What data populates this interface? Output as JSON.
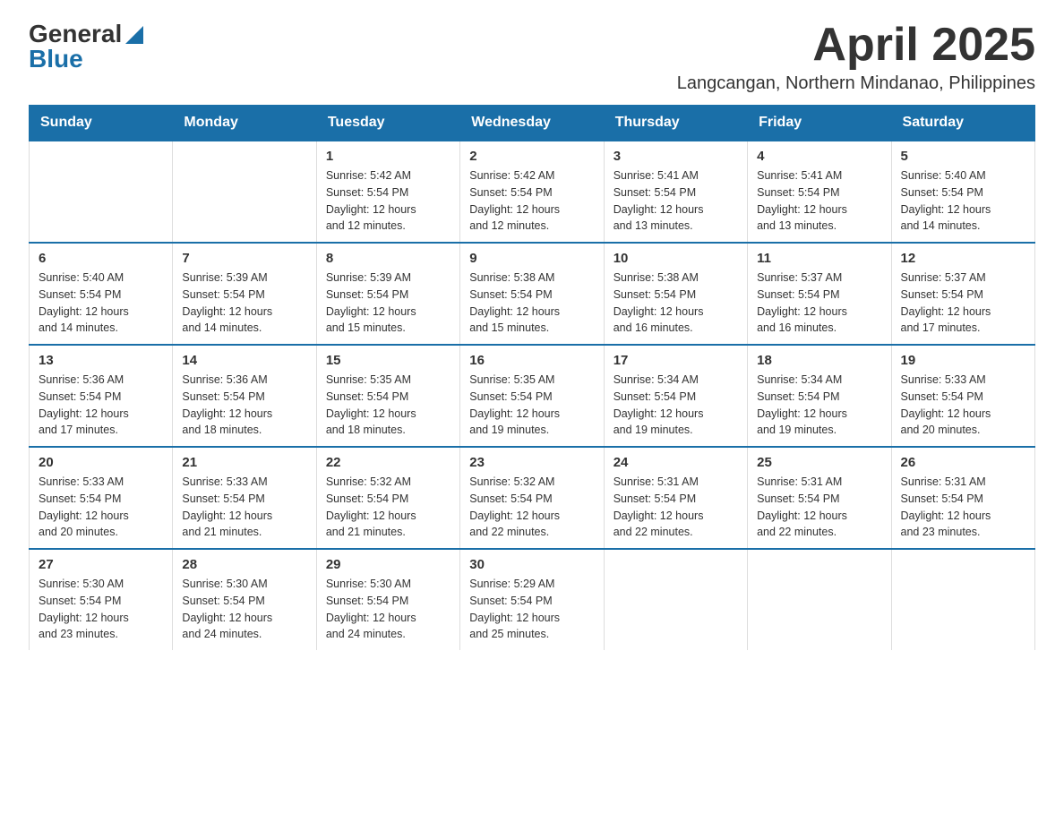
{
  "logo": {
    "general": "General",
    "blue": "Blue"
  },
  "title": "April 2025",
  "location": "Langcangan, Northern Mindanao, Philippines",
  "header": {
    "days": [
      "Sunday",
      "Monday",
      "Tuesday",
      "Wednesday",
      "Thursday",
      "Friday",
      "Saturday"
    ]
  },
  "weeks": [
    [
      {
        "day": "",
        "info": ""
      },
      {
        "day": "",
        "info": ""
      },
      {
        "day": "1",
        "info": "Sunrise: 5:42 AM\nSunset: 5:54 PM\nDaylight: 12 hours\nand 12 minutes."
      },
      {
        "day": "2",
        "info": "Sunrise: 5:42 AM\nSunset: 5:54 PM\nDaylight: 12 hours\nand 12 minutes."
      },
      {
        "day": "3",
        "info": "Sunrise: 5:41 AM\nSunset: 5:54 PM\nDaylight: 12 hours\nand 13 minutes."
      },
      {
        "day": "4",
        "info": "Sunrise: 5:41 AM\nSunset: 5:54 PM\nDaylight: 12 hours\nand 13 minutes."
      },
      {
        "day": "5",
        "info": "Sunrise: 5:40 AM\nSunset: 5:54 PM\nDaylight: 12 hours\nand 14 minutes."
      }
    ],
    [
      {
        "day": "6",
        "info": "Sunrise: 5:40 AM\nSunset: 5:54 PM\nDaylight: 12 hours\nand 14 minutes."
      },
      {
        "day": "7",
        "info": "Sunrise: 5:39 AM\nSunset: 5:54 PM\nDaylight: 12 hours\nand 14 minutes."
      },
      {
        "day": "8",
        "info": "Sunrise: 5:39 AM\nSunset: 5:54 PM\nDaylight: 12 hours\nand 15 minutes."
      },
      {
        "day": "9",
        "info": "Sunrise: 5:38 AM\nSunset: 5:54 PM\nDaylight: 12 hours\nand 15 minutes."
      },
      {
        "day": "10",
        "info": "Sunrise: 5:38 AM\nSunset: 5:54 PM\nDaylight: 12 hours\nand 16 minutes."
      },
      {
        "day": "11",
        "info": "Sunrise: 5:37 AM\nSunset: 5:54 PM\nDaylight: 12 hours\nand 16 minutes."
      },
      {
        "day": "12",
        "info": "Sunrise: 5:37 AM\nSunset: 5:54 PM\nDaylight: 12 hours\nand 17 minutes."
      }
    ],
    [
      {
        "day": "13",
        "info": "Sunrise: 5:36 AM\nSunset: 5:54 PM\nDaylight: 12 hours\nand 17 minutes."
      },
      {
        "day": "14",
        "info": "Sunrise: 5:36 AM\nSunset: 5:54 PM\nDaylight: 12 hours\nand 18 minutes."
      },
      {
        "day": "15",
        "info": "Sunrise: 5:35 AM\nSunset: 5:54 PM\nDaylight: 12 hours\nand 18 minutes."
      },
      {
        "day": "16",
        "info": "Sunrise: 5:35 AM\nSunset: 5:54 PM\nDaylight: 12 hours\nand 19 minutes."
      },
      {
        "day": "17",
        "info": "Sunrise: 5:34 AM\nSunset: 5:54 PM\nDaylight: 12 hours\nand 19 minutes."
      },
      {
        "day": "18",
        "info": "Sunrise: 5:34 AM\nSunset: 5:54 PM\nDaylight: 12 hours\nand 19 minutes."
      },
      {
        "day": "19",
        "info": "Sunrise: 5:33 AM\nSunset: 5:54 PM\nDaylight: 12 hours\nand 20 minutes."
      }
    ],
    [
      {
        "day": "20",
        "info": "Sunrise: 5:33 AM\nSunset: 5:54 PM\nDaylight: 12 hours\nand 20 minutes."
      },
      {
        "day": "21",
        "info": "Sunrise: 5:33 AM\nSunset: 5:54 PM\nDaylight: 12 hours\nand 21 minutes."
      },
      {
        "day": "22",
        "info": "Sunrise: 5:32 AM\nSunset: 5:54 PM\nDaylight: 12 hours\nand 21 minutes."
      },
      {
        "day": "23",
        "info": "Sunrise: 5:32 AM\nSunset: 5:54 PM\nDaylight: 12 hours\nand 22 minutes."
      },
      {
        "day": "24",
        "info": "Sunrise: 5:31 AM\nSunset: 5:54 PM\nDaylight: 12 hours\nand 22 minutes."
      },
      {
        "day": "25",
        "info": "Sunrise: 5:31 AM\nSunset: 5:54 PM\nDaylight: 12 hours\nand 22 minutes."
      },
      {
        "day": "26",
        "info": "Sunrise: 5:31 AM\nSunset: 5:54 PM\nDaylight: 12 hours\nand 23 minutes."
      }
    ],
    [
      {
        "day": "27",
        "info": "Sunrise: 5:30 AM\nSunset: 5:54 PM\nDaylight: 12 hours\nand 23 minutes."
      },
      {
        "day": "28",
        "info": "Sunrise: 5:30 AM\nSunset: 5:54 PM\nDaylight: 12 hours\nand 24 minutes."
      },
      {
        "day": "29",
        "info": "Sunrise: 5:30 AM\nSunset: 5:54 PM\nDaylight: 12 hours\nand 24 minutes."
      },
      {
        "day": "30",
        "info": "Sunrise: 5:29 AM\nSunset: 5:54 PM\nDaylight: 12 hours\nand 25 minutes."
      },
      {
        "day": "",
        "info": ""
      },
      {
        "day": "",
        "info": ""
      },
      {
        "day": "",
        "info": ""
      }
    ]
  ]
}
